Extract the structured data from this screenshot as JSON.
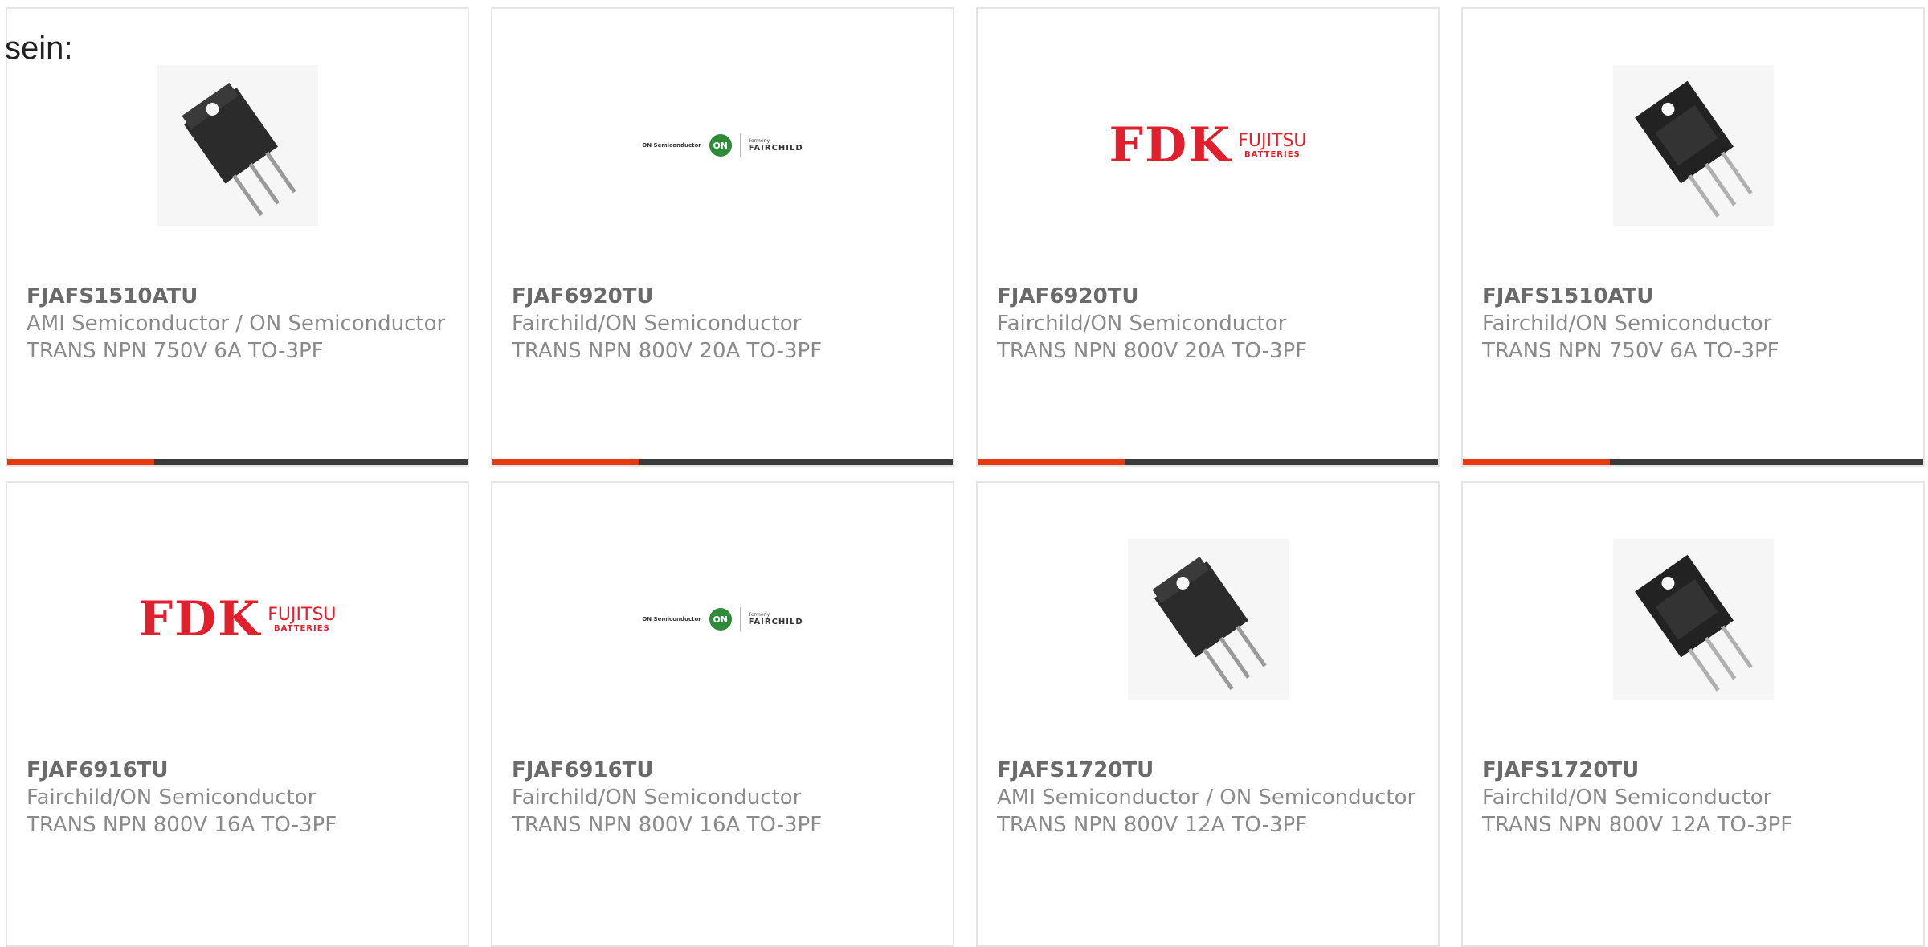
{
  "intro_text": "sein:",
  "brand_colors": {
    "accent": "#e8390e",
    "bar": "#3a3a3a",
    "fdk_red": "#e0202c",
    "on_green": "#2e8b3a"
  },
  "logos": {
    "fdk": {
      "main": "FDK",
      "sub": "FUJITSU",
      "tag": "BATTERIES"
    },
    "onsemi": {
      "left": "ON Semiconductor",
      "circle": "ON",
      "formerly": "Formerly",
      "name": "FAIRCHILD"
    }
  },
  "products": [
    {
      "image": "transistor-photo",
      "part": "FJAFS1510ATU",
      "manufacturer": "AMI Semiconductor / ON Semiconductor",
      "description": "TRANS NPN 750V 6A TO-3PF"
    },
    {
      "image": "onsemi-fairchild-logo",
      "part": "FJAF6920TU",
      "manufacturer": "Fairchild/ON Semiconductor",
      "description": "TRANS NPN 800V 20A TO-3PF"
    },
    {
      "image": "fdk-fujitsu-logo",
      "part": "FJAF6920TU",
      "manufacturer": "Fairchild/ON Semiconductor",
      "description": "TRANS NPN 800V 20A TO-3PF"
    },
    {
      "image": "transistor-photo",
      "part": "FJAFS1510ATU",
      "manufacturer": "Fairchild/ON Semiconductor",
      "description": "TRANS NPN 750V 6A TO-3PF"
    },
    {
      "image": "fdk-fujitsu-logo",
      "part": "FJAF6916TU",
      "manufacturer": "Fairchild/ON Semiconductor",
      "description": "TRANS NPN 800V 16A TO-3PF"
    },
    {
      "image": "onsemi-fairchild-logo",
      "part": "FJAF6916TU",
      "manufacturer": "Fairchild/ON Semiconductor",
      "description": "TRANS NPN 800V 16A TO-3PF"
    },
    {
      "image": "transistor-photo",
      "part": "FJAFS1720TU",
      "manufacturer": "AMI Semiconductor / ON Semiconductor",
      "description": "TRANS NPN 800V 12A TO-3PF"
    },
    {
      "image": "transistor-photo",
      "part": "FJAFS1720TU",
      "manufacturer": "Fairchild/ON Semiconductor",
      "description": "TRANS NPN 800V 12A TO-3PF"
    }
  ]
}
